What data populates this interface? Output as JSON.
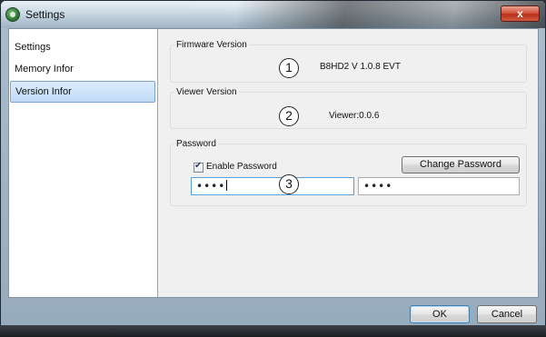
{
  "window": {
    "title": "Settings",
    "close_label": "x"
  },
  "sidebar": {
    "items": [
      {
        "label": "Settings",
        "selected": false
      },
      {
        "label": "Memory Infor",
        "selected": false
      },
      {
        "label": "Version Infor",
        "selected": true
      }
    ]
  },
  "firmware": {
    "legend": "Firmware Version",
    "value": "B8HD2 V 1.0.8 EVT",
    "callout": "1"
  },
  "viewer": {
    "legend": "Viewer Version",
    "value": "Viewer:0.0.6",
    "callout": "2"
  },
  "password": {
    "legend": "Password",
    "enable_label": "Enable Password",
    "enabled": true,
    "change_label": "Change Password",
    "field1_value": "••••",
    "field2_value": "••••",
    "callout": "3"
  },
  "footer": {
    "ok_label": "OK",
    "cancel_label": "Cancel"
  },
  "colors": {
    "selection": "#c1dcf8",
    "close_button": "#c8402a",
    "accent_border": "#5aa0d8"
  },
  "icons": {
    "app": "app-icon",
    "close": "close-icon",
    "check": "checkmark-icon"
  }
}
